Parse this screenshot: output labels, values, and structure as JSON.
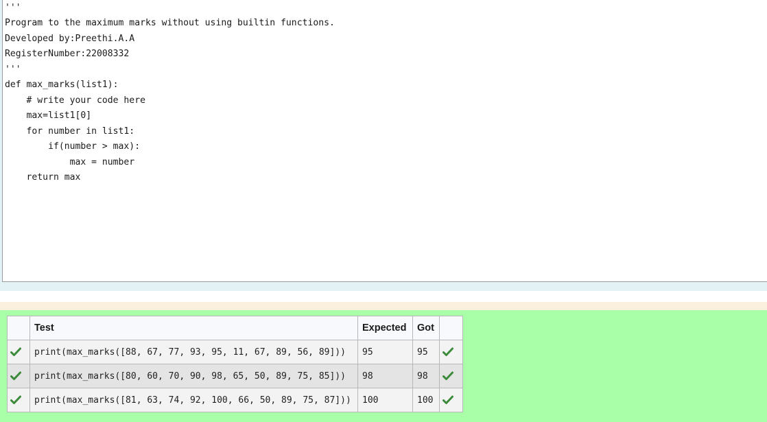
{
  "editor": {
    "lines": [
      "'''",
      "Program to the maximum marks without using builtin functions.",
      "Developed by:Preethi.A.A",
      "RegisterNumber:22008332",
      "'''",
      "def max_marks(list1):",
      "    # write your code here",
      "    max=list1[0]",
      "    for number in list1:",
      "        if(number > max):",
      "            max = number",
      "    return max"
    ]
  },
  "results": {
    "headers": {
      "test": "Test",
      "expected": "Expected",
      "got": "Got"
    },
    "rows": [
      {
        "test": "print(max_marks([88, 67, 77, 93, 95, 11, 67, 89, 56, 89]))",
        "expected": "95",
        "got": "95",
        "status": "pass"
      },
      {
        "test": "print(max_marks([80, 60, 70, 90, 98, 65, 50, 89, 75, 85]))",
        "expected": "98",
        "got": "98",
        "status": "pass"
      },
      {
        "test": "print(max_marks([81, 63, 74, 92, 100, 66, 50, 89, 75, 87]))",
        "expected": "100",
        "got": "100",
        "status": "pass"
      }
    ]
  },
  "colors": {
    "pass_green": "#3a8a3a",
    "result_bg": "#a8ffa8",
    "band_cream": "#fbefdd",
    "editor_bg_outer": "#e3f2f5"
  },
  "icons": {
    "status": "check-icon"
  }
}
